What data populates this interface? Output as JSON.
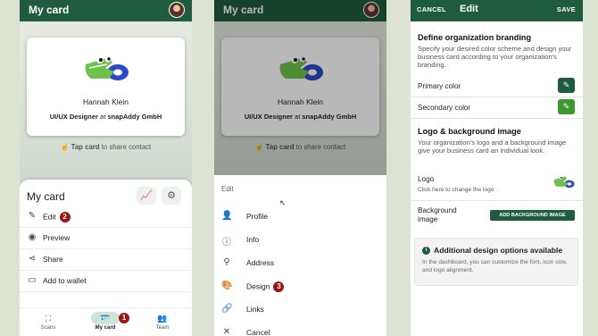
{
  "colors": {
    "brand_green": "#1f5b3e",
    "badge_red": "#9a1616",
    "accent_light_green": "#3a9a2e"
  },
  "screen1": {
    "title": "My card",
    "card": {
      "name": "Hannah Klein",
      "role": "UI/UX Designer",
      "at": "at",
      "company": "snapAddy GmbH"
    },
    "tap_bold": "Tap card",
    "tap_rest": " to share contact",
    "sheet": {
      "title": "My card",
      "items": [
        {
          "label": "Edit",
          "icon": "pencil-icon",
          "badge": "2"
        },
        {
          "label": "Preview",
          "icon": "eye-icon"
        },
        {
          "label": "Share",
          "icon": "share-icon"
        },
        {
          "label": "Add to wallet",
          "icon": "wallet-icon"
        }
      ]
    },
    "nav": [
      {
        "label": "Scans",
        "icon": "scan-icon"
      },
      {
        "label": "My card",
        "icon": "id-card-icon",
        "badge": "1"
      },
      {
        "label": "Team",
        "icon": "team-icon"
      }
    ]
  },
  "screen2": {
    "title": "My card",
    "card": {
      "name": "Hannah Klein",
      "role": "UI/UX Designer",
      "at": "at",
      "company": "snapAddy GmbH"
    },
    "tap_bold": "Tap card",
    "tap_rest": " to share contact",
    "menu_title": "Edit",
    "menu": [
      {
        "label": "Profile",
        "icon": "person-icon"
      },
      {
        "label": "Info",
        "icon": "info-icon"
      },
      {
        "label": "Address",
        "icon": "location-pin-icon"
      },
      {
        "label": "Design",
        "icon": "palette-icon",
        "badge": "3"
      },
      {
        "label": "Links",
        "icon": "link-icon"
      },
      {
        "label": "Cancel",
        "icon": "close-icon"
      }
    ]
  },
  "screen3": {
    "cancel": "CANCEL",
    "title": "Edit",
    "save": "SAVE",
    "branding_heading": "Define organization branding",
    "branding_text": "Specify your desired color scheme and design your business card according to your organization's branding.",
    "primary_color": "Primary color",
    "secondary_color": "Secondary color",
    "logo_heading": "Logo & background image",
    "logo_text": "Your organization's logo and a background image give your business card an individual look.",
    "logo_label": "Logo",
    "logo_hint": "Click here to change the logo",
    "bg_label_1": "Background",
    "bg_label_2": "image",
    "bg_button": "ADD BACKGROUND IMAGE",
    "info_title": "Additional design options available",
    "info_text": "In the dashboard, you can customize the font, icon size, and logo alignment."
  }
}
